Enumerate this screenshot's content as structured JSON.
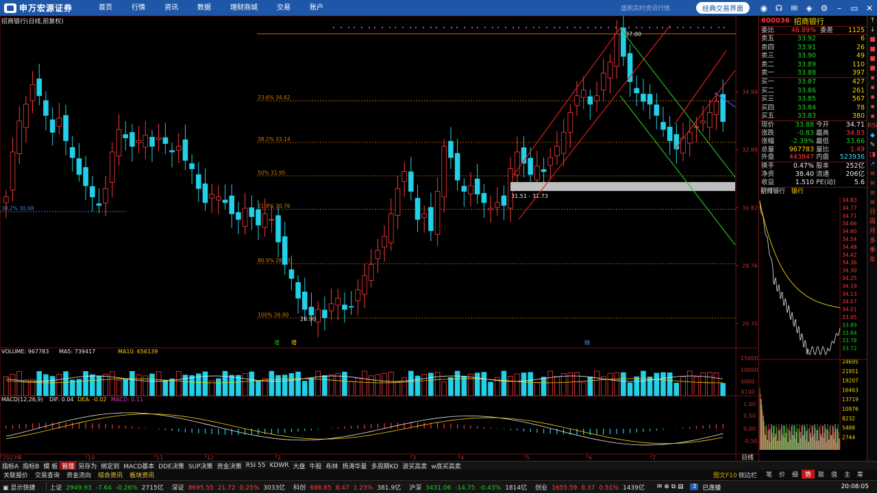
{
  "topbar": {
    "logo_text": "申万宏源证券",
    "nav": [
      "首页",
      "行情",
      "资讯",
      "数据",
      "理财商城",
      "交易",
      "账户"
    ],
    "quote_mode": "盛帆实时资讯行情",
    "classic_btn": "经典交易界面"
  },
  "chart": {
    "stock_title": "招商银行(日线,前复权)",
    "ytick_right": [
      "34.94",
      "32.88",
      "30.82",
      "28.76",
      "26.70"
    ],
    "fib_labels": [
      "23.6% 34.62",
      "38.2% 33.14",
      "50% 31.95",
      "61.8% 30.76",
      "80.9% 28.83",
      "100% 26.90"
    ],
    "left_fib_label": "38.2% 30.68",
    "high_label": "37.00",
    "low_label": "26.90",
    "zone_label": "31.51 - 31.73",
    "event_markers": [
      "增",
      "增",
      "财"
    ],
    "volume_header": {
      "label": "VOLUME: 967783",
      "ma5": "MA5: 739417",
      "ma10": "MA10: 656139"
    },
    "volume_ticks": [
      "15000",
      "10000",
      "5000",
      "X100"
    ],
    "macd_header": {
      "label": "MACD(12,26,9)",
      "dif": "DIF: 0.04",
      "dea": "DEA: -0.02",
      "macd": "MACD: 0.11"
    },
    "macd_ticks": [
      "1.00",
      "0.50",
      "0.00",
      "-0.50"
    ],
    "months": [
      "2023年",
      "10",
      "11",
      "12",
      "2",
      "3",
      "4",
      "5",
      "6",
      "7"
    ],
    "period": "日线",
    "price_series": [
      31.2,
      32.8,
      33.9,
      34.5,
      35.2,
      34.8,
      34.1,
      33.5,
      34.0,
      33.2,
      32.6,
      32.0,
      31.6,
      31.2,
      30.9,
      31.5,
      32.8,
      33.6,
      33.3,
      33.0,
      33.2,
      33.4,
      33.0,
      33.3,
      33.1,
      32.8,
      33.0,
      32.5,
      32.2,
      31.5,
      31.0,
      31.3,
      31.2,
      31.0,
      30.6,
      30.4,
      30.8,
      30.5,
      30.2,
      30.6,
      30.4,
      29.6,
      28.8,
      28.3,
      27.6,
      27.2,
      27.0,
      27.2,
      26.9,
      27.4,
      27.6,
      27.2,
      27.3,
      27.9,
      28.4,
      28.8,
      29.3,
      29.8,
      30.6,
      31.5,
      32.1,
      31.4,
      30.4,
      30.6,
      30.0,
      31.4,
      33.0,
      32.6,
      31.8,
      31.4,
      31.6,
      31.3,
      31.0,
      30.8,
      31.0,
      30.9,
      32.2,
      32.8,
      32.4,
      32.0,
      32.3,
      32.1,
      32.6,
      33.0,
      33.5,
      34.2,
      34.8,
      35.0,
      34.5,
      34.8,
      35.6,
      36.0,
      37.0,
      36.2,
      35.3,
      34.9,
      34.6,
      34.5,
      34.1,
      33.6,
      33.2,
      32.9,
      33.3,
      33.5,
      33.7,
      33.9,
      34.2,
      34.6,
      33.88
    ],
    "fib_levels": [
      34.62,
      33.14,
      31.95,
      30.76,
      28.83,
      26.9
    ]
  },
  "quote": {
    "code": "600036",
    "name": "招商银行",
    "wb": {
      "label": "委比",
      "value": "48.89%",
      "diff_label": "委差",
      "diff": "1125"
    },
    "asks": [
      {
        "label": "卖五",
        "price": "33.92",
        "vol": "6"
      },
      {
        "label": "卖四",
        "price": "33.91",
        "vol": "26"
      },
      {
        "label": "卖三",
        "price": "33.90",
        "vol": "49"
      },
      {
        "label": "卖二",
        "price": "33.89",
        "vol": "110"
      },
      {
        "label": "卖一",
        "price": "33.88",
        "vol": "397"
      }
    ],
    "bids": [
      {
        "label": "买一",
        "price": "33.87",
        "vol": "427"
      },
      {
        "label": "买二",
        "price": "33.86",
        "vol": "261"
      },
      {
        "label": "买三",
        "price": "33.85",
        "vol": "567"
      },
      {
        "label": "买四",
        "price": "33.84",
        "vol": "78"
      },
      {
        "label": "买五",
        "price": "33.83",
        "vol": "380"
      }
    ],
    "stats": [
      {
        "k1": "现价",
        "v1": "33.88",
        "c1": "green",
        "k2": "今开",
        "v2": "34.71",
        "c2": "white"
      },
      {
        "k1": "涨跌",
        "v1": "-0.83",
        "c1": "green",
        "k2": "最高",
        "v2": "34.83",
        "c2": "red"
      },
      {
        "k1": "涨幅",
        "v1": "-2.39%",
        "c1": "green",
        "k2": "最低",
        "v2": "33.66",
        "c2": "green"
      },
      {
        "k1": "总量",
        "v1": "967783",
        "c1": "yellow",
        "k2": "量比",
        "v2": "1.49",
        "c2": "red"
      },
      {
        "k1": "外盘",
        "v1": "443847",
        "c1": "red",
        "k2": "内盘",
        "v2": "523936",
        "c2": "cyan"
      }
    ],
    "stats2": [
      {
        "k1": "换手",
        "v1": "0.47%",
        "k2": "股本",
        "v2": "252亿"
      },
      {
        "k1": "净资",
        "v1": "38.40",
        "k2": "流通",
        "v2": "206亿"
      },
      {
        "k1": "收益(一)",
        "v1": "1.510",
        "k2": "PE(动)",
        "v2": "5.6"
      }
    ],
    "mini": {
      "name": "招商银行",
      "tag": "银行",
      "price_ticks": [
        "34.83",
        "34.77",
        "34.71",
        "34.66",
        "34.60",
        "34.54",
        "34.48",
        "34.42",
        "34.36",
        "34.30",
        "34.25",
        "34.19",
        "34.13",
        "34.07",
        "34.01",
        "33.95",
        "33.89",
        "33.84",
        "33.78",
        "33.72"
      ],
      "vol_ticks": [
        "24695",
        "21951",
        "19207",
        "16463",
        "13719",
        "10976",
        "8232",
        "5488",
        "2744"
      ]
    },
    "side_icons": [
      "↑",
      "↓",
      "■",
      "■",
      "■",
      "■",
      "▪",
      "▪",
      "▪",
      "▪",
      "▪",
      "RSI",
      "◆",
      "✎",
      "◨",
      "↗",
      "≡",
      "≡",
      "≡",
      "≡",
      "日",
      "周",
      "月",
      "多",
      "季",
      "年"
    ]
  },
  "bottom": {
    "tabs1": [
      "指标A",
      "指标B",
      "模 板",
      "管理",
      "另存为",
      "绑定到",
      "MACD基本",
      "DDE决策",
      "SUP决策",
      "资金决策",
      "RSI 55",
      "KDWR",
      "大盘",
      "牛股",
      "布林",
      "扬涛华量",
      "多周期KD",
      "波买高卖",
      "w底买高卖"
    ],
    "active_tab1": 3,
    "tabs2": [
      "关联报价",
      "交易查询",
      "资金流向",
      "综合资讯",
      "板块资讯"
    ],
    "tabs2_yellow": [
      3,
      4
    ],
    "right_link1": "图文F10",
    "right_link2": "侧边栏",
    "tabs3": [
      "笔",
      "价",
      "细",
      "势",
      "联",
      "值",
      "主",
      "筹"
    ],
    "active_tab3": 3
  },
  "status": {
    "label": "显示快捷",
    "items": [
      {
        "name": "上证",
        "price": "2949.93",
        "chg": "-7.64",
        "pct": "-0.26%",
        "amt": "2715亿"
      },
      {
        "name": "深证",
        "price": "8695.55",
        "chg": "21.72",
        "pct": "0.25%",
        "amt": "3033亿"
      },
      {
        "name": "科创",
        "price": "698.85",
        "chg": "8.47",
        "pct": "1.23%",
        "amt": "381.9亿"
      },
      {
        "name": "沪深",
        "price": "3431.06",
        "chg": "-14.75",
        "pct": "-0.43%",
        "amt": "1814亿"
      },
      {
        "name": "创业",
        "price": "1655.59",
        "chg": "8.37",
        "pct": "0.51%",
        "amt": "1439亿"
      }
    ],
    "conn": "已连接",
    "time": "20:08:05"
  },
  "colors": {
    "up": "#ff3b3b",
    "down": "#22d0e8",
    "nav_bg": "#1f57a8",
    "fib": "#ff8c00"
  }
}
